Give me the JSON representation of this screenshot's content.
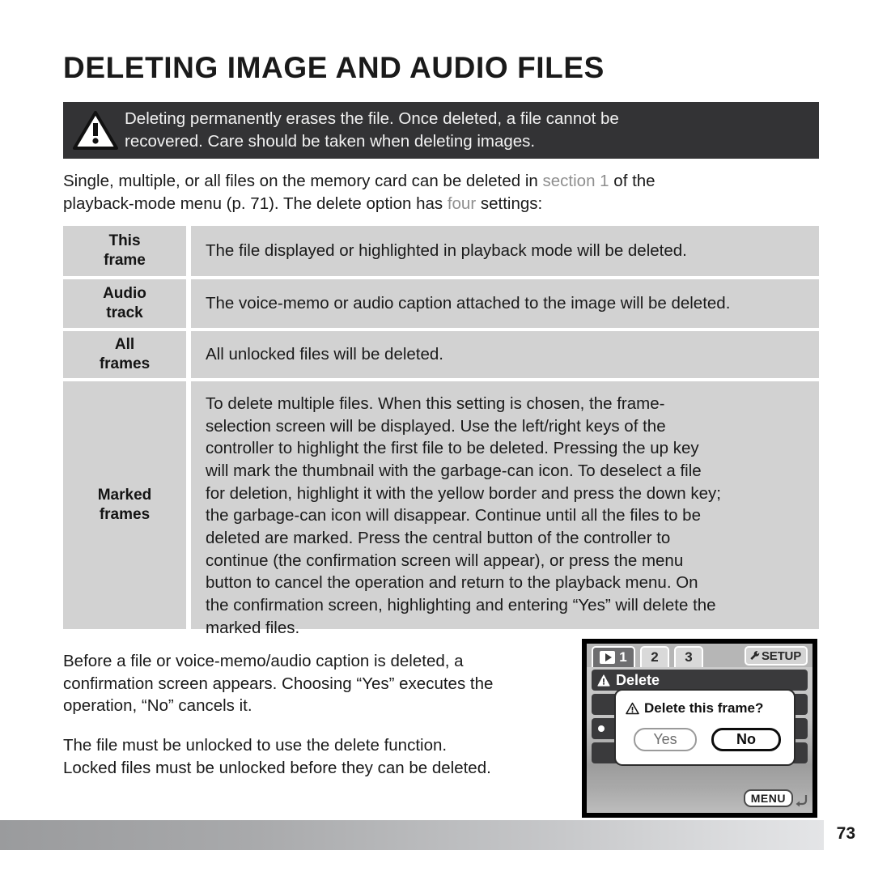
{
  "document": {
    "title": "DELETING IMAGE AND AUDIO FILES",
    "page_number": "73"
  },
  "warning_banner": {
    "icon": "warning-triangle-icon",
    "line1": "Deleting permanently erases the file. Once deleted, a file cannot be",
    "line2": "recovered. Care should be taken when deleting images.",
    "background_color": "#333335",
    "text_color": "#f2f2f2"
  },
  "intro": {
    "line1_a": "Single, multiple, or all files on the memory card can be deleted in ",
    "line1_gray": "section 1",
    "line1_b": " of the",
    "line2_a": "playback-mode menu (p. 71). The delete option has ",
    "line2_gray": "four",
    "line2_b": " settings:",
    "gray_color": "#8f8f8f"
  },
  "settings_table": {
    "rows": [
      {
        "label_line1": "This",
        "label_line2": "frame",
        "description": "The file displayed or highlighted in playback mode will be deleted."
      },
      {
        "label_line1": "Audio",
        "label_line2": "track",
        "description": "The voice-memo or audio caption attached to the image will be deleted."
      },
      {
        "label_line1": "All",
        "label_line2": "frames",
        "description": "All unlocked files will be deleted."
      },
      {
        "label_line1": "Marked",
        "label_line2": "frames",
        "description_lines": [
          "To delete multiple files. When this setting is chosen, the frame-",
          "selection screen will be displayed. Use the left/right keys of the",
          "controller to highlight the first file to be deleted. Pressing the up key",
          "will mark the thumbnail with the garbage-can icon. To deselect a file",
          "for deletion, highlight it with the yellow border and press the down key;",
          "the garbage-can icon will disappear. Continue until all the files to be",
          "deleted are marked. Press the central button of the controller to",
          "continue (the confirmation screen will appear), or press the menu",
          "button to cancel the operation and return to the playback menu. On",
          "the confirmation screen, highlighting and entering “Yes” will delete the",
          "marked files."
        ]
      }
    ],
    "cell_background": "#d2d2d2"
  },
  "paragraphs": [
    {
      "lines": [
        "Before a file or voice-memo/audio caption is deleted, a",
        "confirmation screen appears. Choosing “Yes” executes the",
        "operation, “No” cancels it."
      ]
    },
    {
      "lines": [
        "The file must be unlocked to use the delete function.",
        "Locked files must be unlocked before they can be deleted."
      ]
    }
  ],
  "camera_lcd": {
    "tabs": [
      {
        "id": "tab-playback-1",
        "label": "1",
        "icon": "playback-triangle-icon",
        "selected": true
      },
      {
        "id": "tab-2",
        "label": "2",
        "icon": "",
        "selected": false
      },
      {
        "id": "tab-3",
        "label": "3",
        "icon": "",
        "selected": false
      }
    ],
    "setup_tab": {
      "label": "SETUP",
      "icon": "wrench-icon"
    },
    "menu_header": {
      "icon": "warning-triangle-icon",
      "label": "Delete"
    },
    "dialog": {
      "icon": "warning-triangle-icon",
      "message": "Delete this frame?",
      "buttons": [
        {
          "label": "Yes",
          "selected": false
        },
        {
          "label": "No",
          "selected": true
        }
      ]
    },
    "footer": {
      "menu_label": "MENU",
      "return_icon": "return-arrow-icon"
    }
  }
}
